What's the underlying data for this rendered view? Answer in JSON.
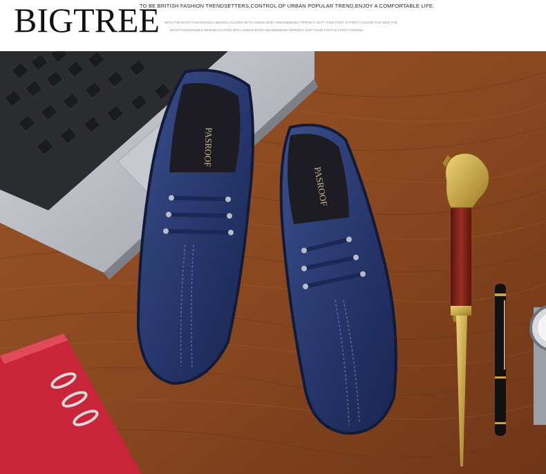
{
  "header": {
    "brand": "BIGTREE",
    "tagline": "TO BE BRITISH FASHION TRENDSETTERS,CONTROL OF URBAN POPULAR TREND,ENJOY A COMFORTABLE LIFE.",
    "subline_1": "WITH THE MOST FASHIONABLE DESIGN ACCORD WITH HUMAN BODY ENGINEERING PERFECT SUIT YOUR FOOT IS FIRST CHOOSE THE NEW THE",
    "subline_2": "MOST FASHIONABLE DESIGN ACCORD WITH HUMAN BODY ENGINEERING PERFECT SUIT YOUR FOOT IS FIRST CHOOSE"
  },
  "photo": {
    "insole_brand": "PASROOF",
    "subjects": [
      "laptop",
      "shoe-left",
      "shoe-right",
      "notebook",
      "ornamental-cane",
      "fountain-pen",
      "wristwatch"
    ],
    "colors": {
      "wood": "#8a4a22",
      "shoe": "#2a3a6e",
      "laptop": "#b9bcc2",
      "notebook": "#c8243a",
      "cane": "#7a1e14",
      "gold": "#c9a441"
    }
  }
}
